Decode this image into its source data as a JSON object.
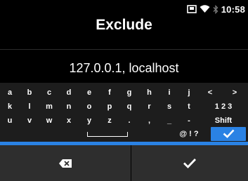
{
  "status": {
    "time": "10:58",
    "icons": [
      "storage-card-icon",
      "wifi-icon",
      "bluetooth-icon"
    ]
  },
  "title": "Exclude",
  "input": {
    "value": "127.0.0.1, localhost"
  },
  "keyboard": {
    "rows": [
      [
        "a",
        "b",
        "c",
        "d",
        "e",
        "f",
        "g",
        "h",
        "i",
        "j",
        "<",
        ">"
      ],
      [
        "k",
        "l",
        "m",
        "n",
        "o",
        "p",
        "q",
        "r",
        "s",
        "t",
        "1 2 3"
      ],
      [
        "u",
        "v",
        "w",
        "x",
        "y",
        "z",
        ".",
        ",",
        "_",
        "-",
        "Shift"
      ]
    ],
    "symbols_label": "@ ! ?",
    "ok_icon": "checkmark-icon",
    "space_icon": "space-icon"
  },
  "buttons": {
    "delete_icon": "backspace-icon",
    "confirm_icon": "checkmark-icon"
  },
  "colors": {
    "accent": "#2a82e4",
    "keyboard_bg": "#1d1d1d",
    "bottom_bg": "#2e2e2e",
    "text": "#ffffff"
  }
}
